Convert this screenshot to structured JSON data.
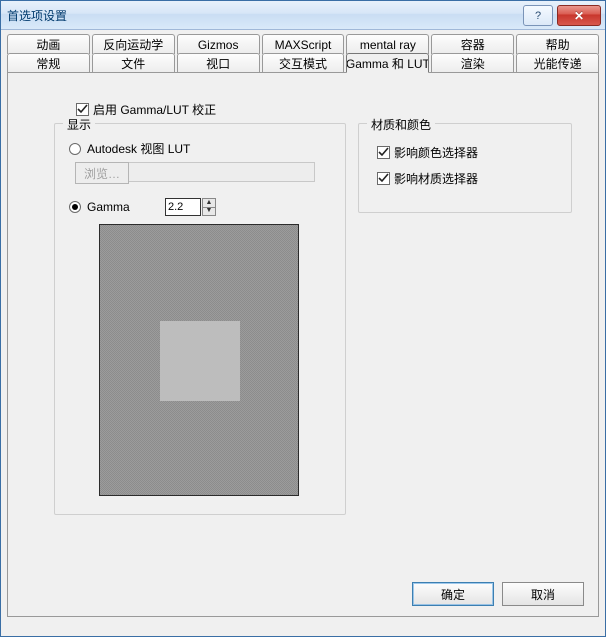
{
  "title": "首选项设置",
  "titlebar": {
    "help_symbol": "?",
    "close_symbol": "✕"
  },
  "tabs_top": [
    "动画",
    "反向运动学",
    "Gizmos",
    "MAXScript",
    "mental ray",
    "容器",
    "帮助"
  ],
  "tabs_bottom": [
    "常规",
    "文件",
    "视口",
    "交互模式",
    "Gamma 和 LUT",
    "渲染",
    "光能传递"
  ],
  "active_tab": "Gamma 和 LUT",
  "enable_label": "启用 Gamma/LUT 校正",
  "enable_checked": true,
  "group_display": {
    "legend": "显示",
    "radio_lut_label": "Autodesk 视图 LUT",
    "radio_lut_selected": false,
    "browse_label": "浏览…",
    "browse_path": "",
    "radio_gamma_label": "Gamma",
    "radio_gamma_selected": true,
    "gamma_value": "2.2"
  },
  "group_material": {
    "legend": "材质和颜色",
    "affect_color_label": "影响颜色选择器",
    "affect_color_checked": true,
    "affect_mat_label": "影响材质选择器",
    "affect_mat_checked": true
  },
  "buttons": {
    "ok": "确定",
    "cancel": "取消"
  }
}
